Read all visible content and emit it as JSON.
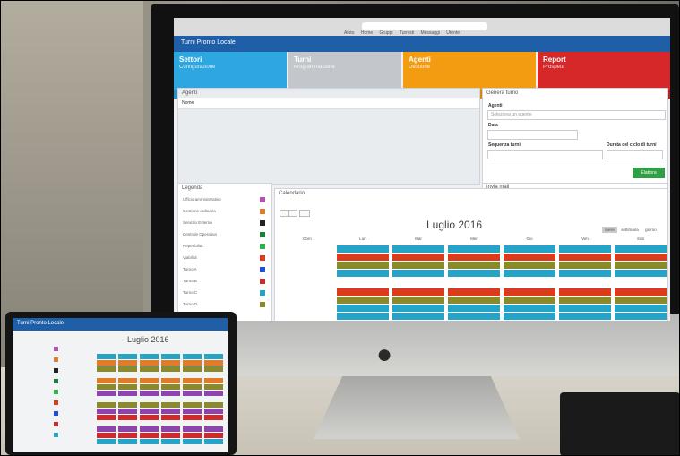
{
  "browser": {
    "url": "",
    "menu": [
      "Aiuto",
      "Home",
      "Gruppi",
      "Turnisti",
      "Messaggi",
      "Utente"
    ]
  },
  "app": {
    "brand": "Turni Pronto Locale",
    "user": ""
  },
  "tiles": [
    {
      "title": "Settori",
      "subtitle": "Configurazione",
      "color": "#2ea7e0"
    },
    {
      "title": "Turni",
      "subtitle": "Programmazione",
      "color": "#c3c7cc"
    },
    {
      "title": "Agenti",
      "subtitle": "Gestione",
      "color": "#f39c12"
    },
    {
      "title": "Report",
      "subtitle": "Prospetti",
      "color": "#d62828"
    }
  ],
  "agents_panel": {
    "title": "Agenti",
    "row": "Nome"
  },
  "generate": {
    "title": "Genera turno",
    "agent_label": "Agenti",
    "agent_placeholder": "Seleziona un agente",
    "date_label": "Data",
    "sequence_label": "Sequenza turni",
    "duration_label": "Durata del ciclo di turni",
    "button": "Elabora"
  },
  "email_panel": {
    "title": "Invia mail"
  },
  "legend": {
    "title": "Legenda",
    "items": [
      {
        "label": "Ufficio amministrativo",
        "color": "#b74fb0"
      },
      {
        "label": "Gestione ordinaria",
        "color": "#e07b2a"
      },
      {
        "label": "Servizio Esterno",
        "color": "#222222"
      },
      {
        "label": "Centrale Operativa",
        "color": "#1a7f3a"
      },
      {
        "label": "Reperibilità",
        "color": "#2fb34a"
      },
      {
        "label": "Viabilità",
        "color": "#d93b1c"
      },
      {
        "label": "Turno A",
        "color": "#1d4fd8"
      },
      {
        "label": "Turno B",
        "color": "#cc2a2a"
      },
      {
        "label": "Turno C",
        "color": "#26a4c7"
      },
      {
        "label": "Turno D",
        "color": "#8a8a2a"
      }
    ]
  },
  "calendar": {
    "panel_title": "Calendario",
    "title": "Luglio 2016",
    "view_buttons": [
      "mese",
      "settimana",
      "giorno"
    ],
    "days": [
      "Dom",
      "Lun",
      "Mar",
      "Mer",
      "Gio",
      "Ven",
      "Sab"
    ]
  },
  "tablet": {
    "brand": "Turni Pronto Locale",
    "calendar_title": "Luglio 2016"
  }
}
